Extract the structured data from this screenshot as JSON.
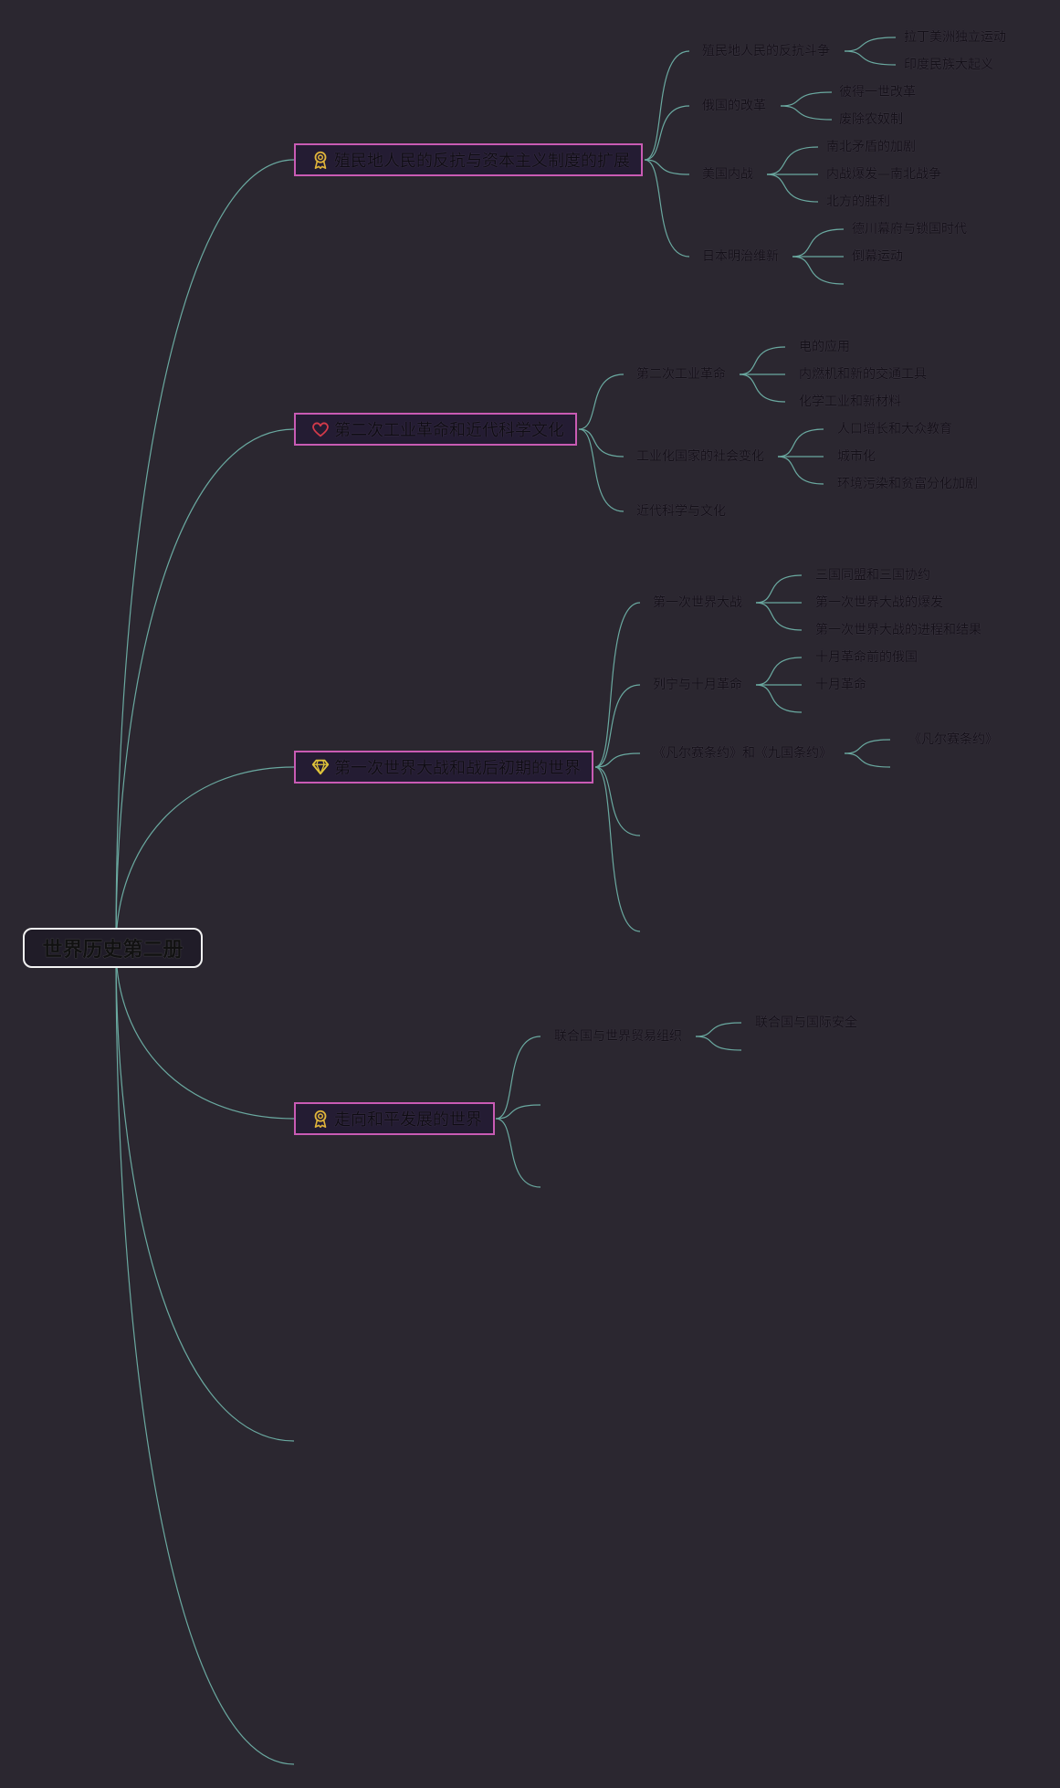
{
  "root": {
    "label": "世界历史第二册"
  },
  "topics": [
    {
      "label": "殖民地人民的反抗与资本主义制度的扩展",
      "icon": "award-ribbon-icon",
      "subs": [
        {
          "label": "殖民地人民的反抗斗争",
          "leaves": [
            "拉丁美洲独立运动",
            "印度民族大起义"
          ]
        },
        {
          "label": "俄国的改革",
          "leaves": [
            "彼得一世改革",
            "废除农奴制"
          ]
        },
        {
          "label": "美国内战",
          "leaves": [
            "南北矛盾的加剧",
            "内战爆发—南北战争",
            "北方的胜利"
          ]
        },
        {
          "label": "日本明治维新",
          "leaves": [
            "德川幕府与锁国时代",
            "倒幕运动",
            ""
          ]
        }
      ]
    },
    {
      "label": "第二次工业革命和近代科学文化",
      "icon": "heart-icon",
      "subs": [
        {
          "label": "第二次工业革命",
          "leaves": [
            "电的应用",
            "内燃机和新的交通工具",
            "化学工业和新材料"
          ]
        },
        {
          "label": "工业化国家的社会变化",
          "leaves": [
            "人口增长和大众教育",
            "城市化",
            "环境污染和贫富分化加剧"
          ]
        },
        {
          "label": "近代科学与文化",
          "leaves": []
        }
      ]
    },
    {
      "label": "第一次世界大战和战后初期的世界",
      "icon": "diamond-icon",
      "subs": [
        {
          "label": "第一次世界大战",
          "leaves": [
            "三国同盟和三国协约",
            "第一次世界大战的爆发",
            "第一次世界大战的进程和结果"
          ]
        },
        {
          "label": "列宁与十月革命",
          "leaves": [
            "十月革命前的俄国",
            "十月革命",
            ""
          ]
        },
        {
          "label": "《凡尔赛条约》和《九国条约》",
          "leaves": [
            "《凡尔赛条约》",
            ""
          ]
        },
        {
          "label": "",
          "leaves": []
        },
        {
          "label": "",
          "leaves": []
        }
      ]
    },
    {
      "label": "走向和平发展的世界",
      "icon": "award-ribbon-icon",
      "subs": [
        {
          "label": "联合国与世界贸易组织",
          "leaves": [
            "联合国与国际安全",
            ""
          ]
        },
        {
          "label": "",
          "leaves": []
        },
        {
          "label": "",
          "leaves": []
        }
      ]
    },
    {
      "label": "",
      "icon": "",
      "subs": []
    },
    {
      "label": "",
      "icon": "",
      "subs": []
    }
  ],
  "colors": {
    "background": "#2b2730",
    "link": "#6aa9a0",
    "topic_border": "#c95bb4",
    "root_border": "#f2f2f2",
    "icon_gold": "#e0b43a",
    "icon_heart": "#d23a4a"
  }
}
